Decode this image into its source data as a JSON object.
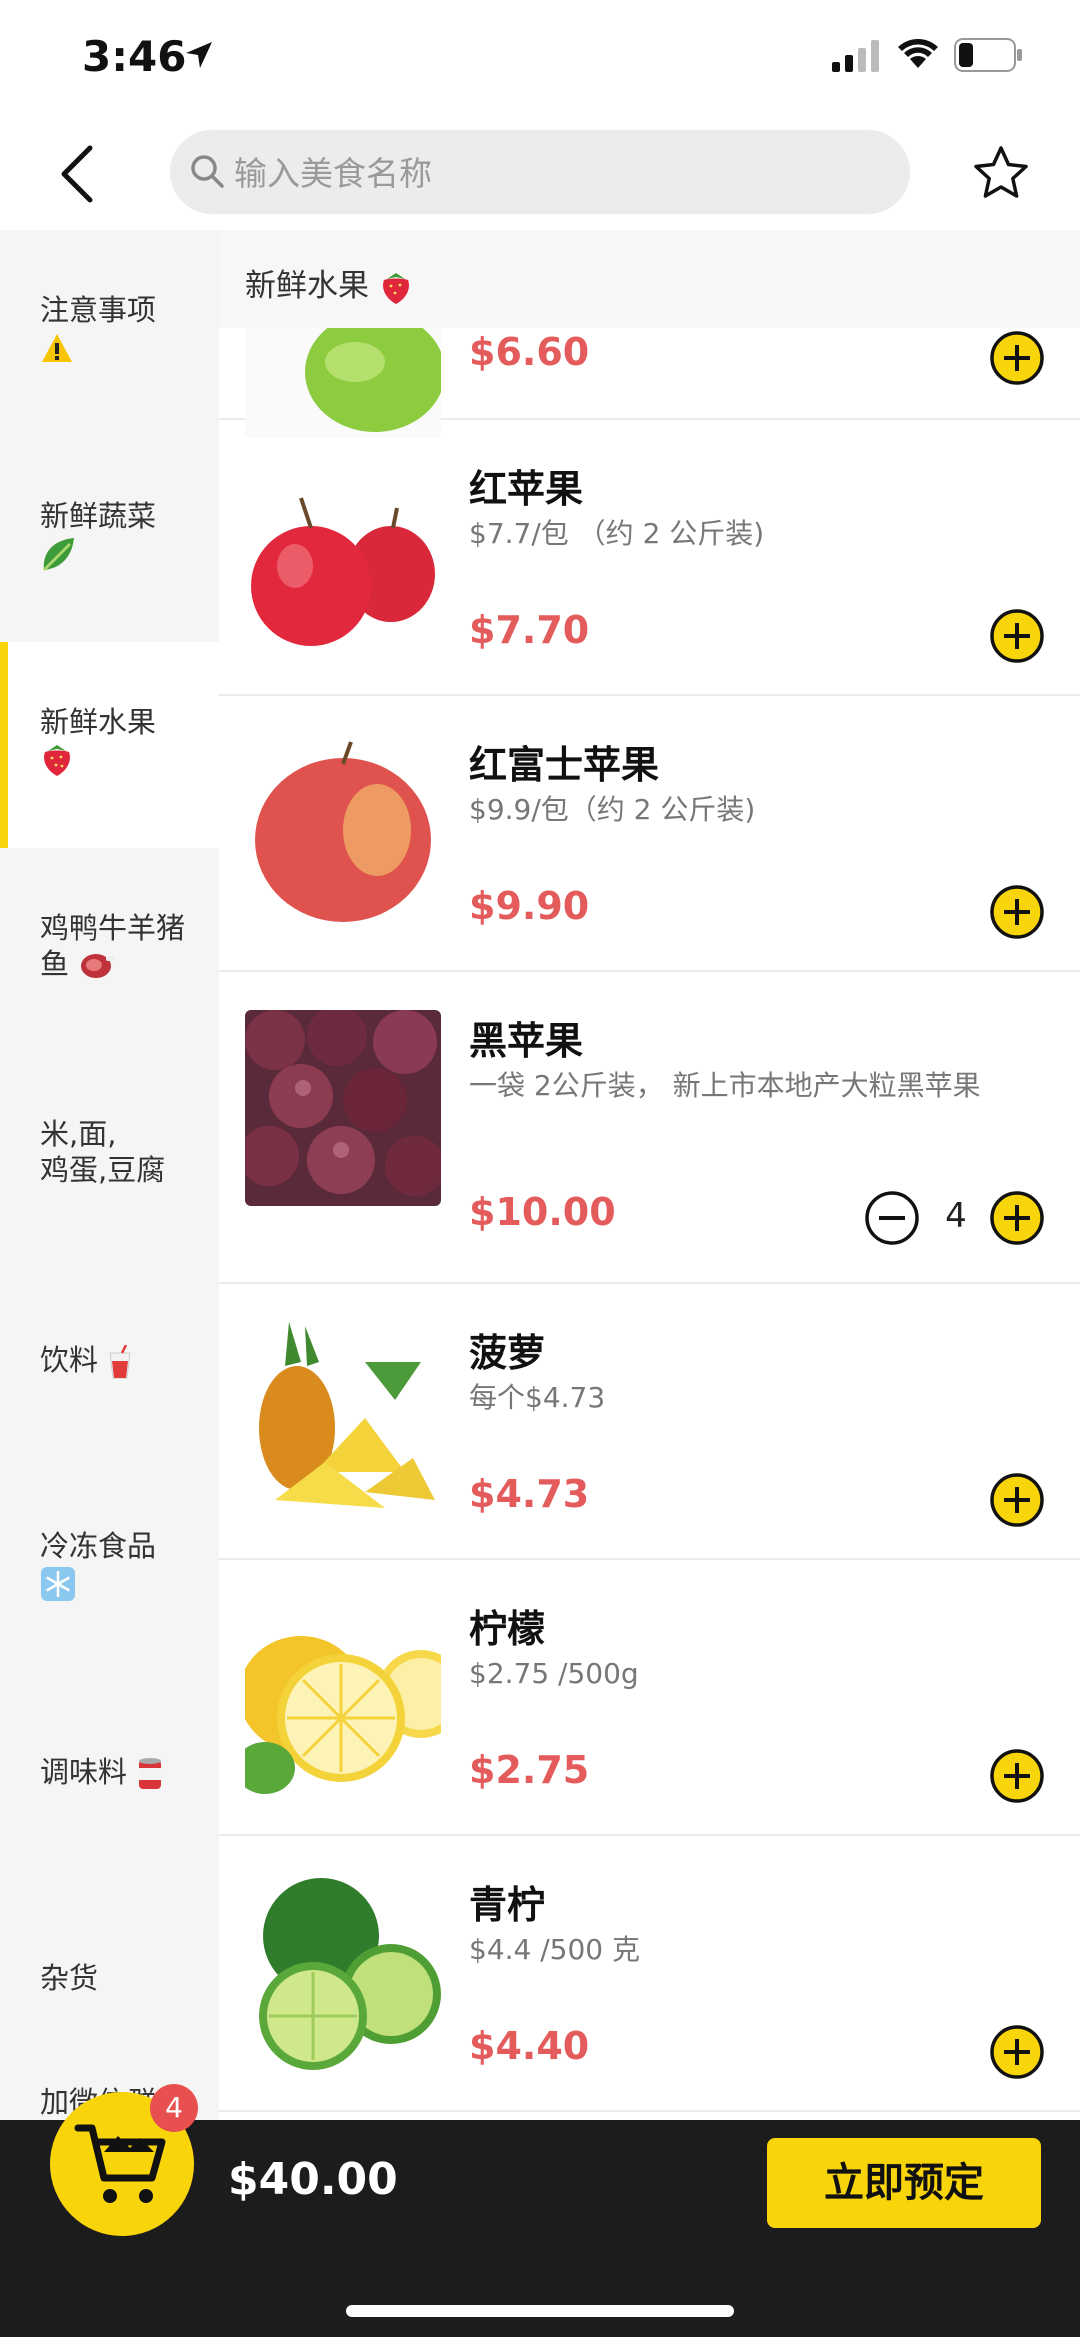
{
  "status_bar": {
    "time": "3:46"
  },
  "search": {
    "placeholder": "输入美食名称"
  },
  "sidebar": {
    "items": [
      {
        "label": "注意事项"
      },
      {
        "label": "新鲜蔬菜"
      },
      {
        "label": "新鲜水果"
      },
      {
        "label": "鸡鸭牛羊猪鱼"
      },
      {
        "label": "米,面,\n鸡蛋,豆腐"
      },
      {
        "label": "饮料"
      },
      {
        "label": "冷冻食品"
      },
      {
        "label": "调味料"
      },
      {
        "label": "杂货"
      },
      {
        "label": "加微信群"
      }
    ],
    "active_index": 2
  },
  "category_header": {
    "label": "新鲜水果"
  },
  "products": [
    {
      "name": "",
      "desc": "",
      "price": "$6.60"
    },
    {
      "name": "红苹果",
      "desc": "$7.7/包 （约 2 公斤装)",
      "price": "$7.70"
    },
    {
      "name": "红富士苹果",
      "desc": "$9.9/包（约 2 公斤装)",
      "price": "$9.90"
    },
    {
      "name": "黑苹果",
      "desc": "一袋 2公斤装， 新上市本地产大粒黑苹果",
      "price": "$10.00",
      "quantity": "4"
    },
    {
      "name": "菠萝",
      "desc": "每个$4.73",
      "price": "$4.73"
    },
    {
      "name": "柠檬",
      "desc": "$2.75 /500g",
      "price": "$2.75"
    },
    {
      "name": "青柠",
      "desc": "$4.4 /500 克",
      "price": "$4.40"
    }
  ],
  "cart": {
    "badge_count": "4",
    "total": "$40.00",
    "order_label": "立即预定"
  },
  "colors": {
    "accent": "#f8d40b",
    "price": "#e45b5b",
    "bottom_bar": "#1c1c1c"
  }
}
